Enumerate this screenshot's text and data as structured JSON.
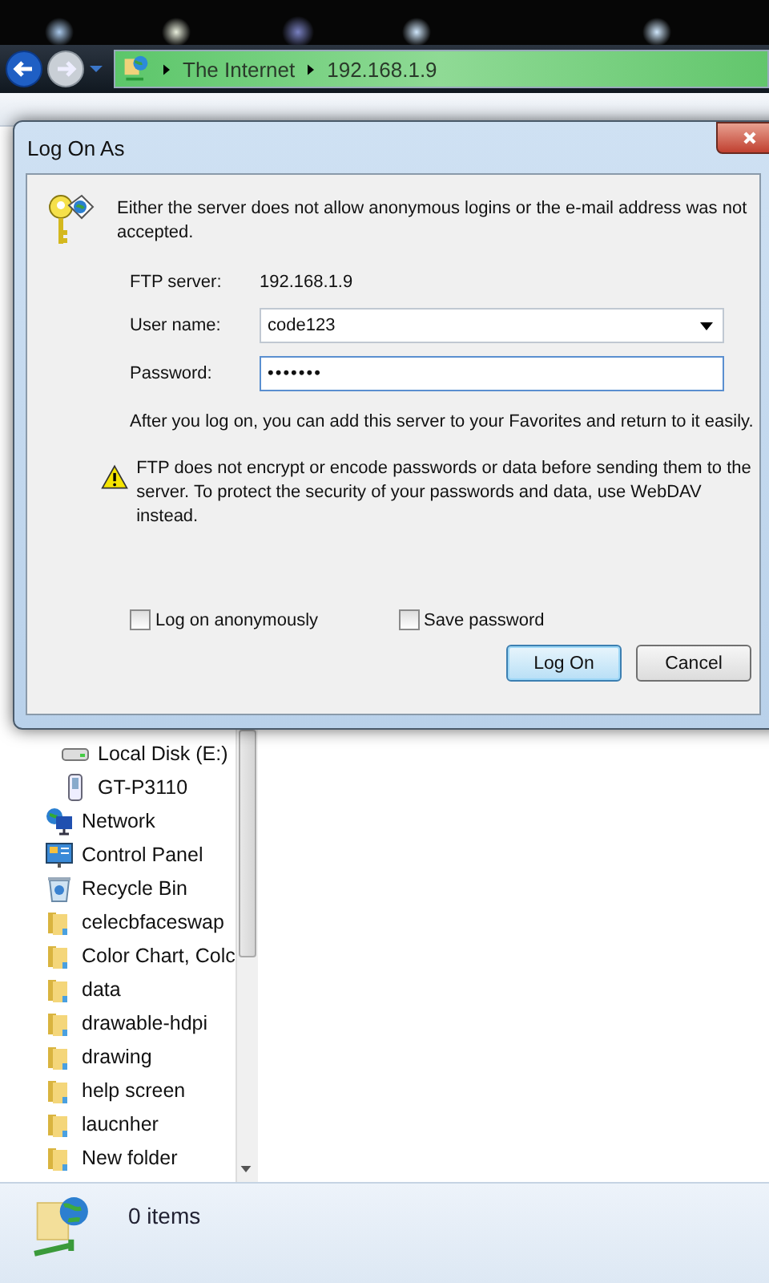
{
  "address_bar": {
    "crumbs": [
      "The Internet",
      "192.168.1.9"
    ]
  },
  "sidebar": {
    "nested_items": [
      {
        "label": "Local Disk (E:)",
        "kind": "drive"
      },
      {
        "label": "GT-P3110",
        "kind": "phone"
      }
    ],
    "items": [
      {
        "label": "Network",
        "kind": "network"
      },
      {
        "label": "Control Panel",
        "kind": "control"
      },
      {
        "label": "Recycle Bin",
        "kind": "bin"
      },
      {
        "label": "celecbfaceswap",
        "kind": "folder"
      },
      {
        "label": "Color Chart, Colc",
        "kind": "folder"
      },
      {
        "label": "data",
        "kind": "folder"
      },
      {
        "label": "drawable-hdpi",
        "kind": "folder"
      },
      {
        "label": "drawing",
        "kind": "folder"
      },
      {
        "label": "help screen",
        "kind": "folder"
      },
      {
        "label": "laucnher",
        "kind": "folder"
      },
      {
        "label": "New folder",
        "kind": "folder"
      }
    ]
  },
  "status_bar": {
    "count": "0 items"
  },
  "dialog": {
    "title": "Log On As",
    "message": "Either the server does not allow anonymous logins or the e-mail address was not accepted.",
    "server_label": "FTP server:",
    "server_value": "192.168.1.9",
    "user_label": "User name:",
    "user_value": "code123",
    "password_label": "Password:",
    "password_value": "•••••••",
    "info": "After you log on, you can add this server to your Favorites and return to it easily.",
    "warning": "FTP does not encrypt or encode passwords or data before sending them to the server.  To protect the security of your passwords and data, use WebDAV instead.",
    "checkboxes": [
      {
        "label": "Log on anonymously",
        "checked": false
      },
      {
        "label": "Save password",
        "checked": false
      }
    ],
    "buttons": [
      {
        "label": "Log On",
        "default": true
      },
      {
        "label": "Cancel",
        "default": false
      }
    ]
  }
}
